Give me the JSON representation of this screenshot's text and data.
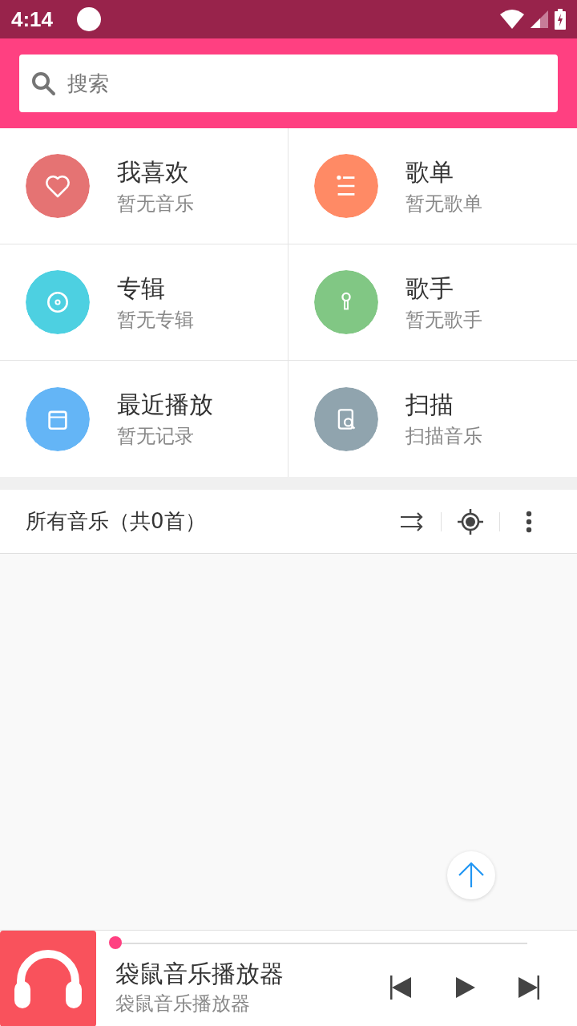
{
  "status_bar": {
    "time": "4:14"
  },
  "search": {
    "placeholder": "搜索"
  },
  "categories": [
    {
      "title": "我喜欢",
      "subtitle": "暂无音乐",
      "color": "#e57373",
      "kind": "heart"
    },
    {
      "title": "歌单",
      "subtitle": "暂无歌单",
      "color": "#ff8a65",
      "kind": "list"
    },
    {
      "title": "专辑",
      "subtitle": "暂无专辑",
      "color": "#4dd0e1",
      "kind": "disc"
    },
    {
      "title": "歌手",
      "subtitle": "暂无歌手",
      "color": "#81c784",
      "kind": "mic"
    },
    {
      "title": "最近播放",
      "subtitle": "暂无记录",
      "color": "#64b5f6",
      "kind": "window"
    },
    {
      "title": "扫描",
      "subtitle": "扫描音乐",
      "color": "#90a4ae",
      "kind": "scan"
    }
  ],
  "list_header": {
    "title": "所有音乐（共0首）"
  },
  "player": {
    "title": "袋鼠音乐播放器",
    "subtitle": "袋鼠音乐播放器",
    "level": 0
  }
}
